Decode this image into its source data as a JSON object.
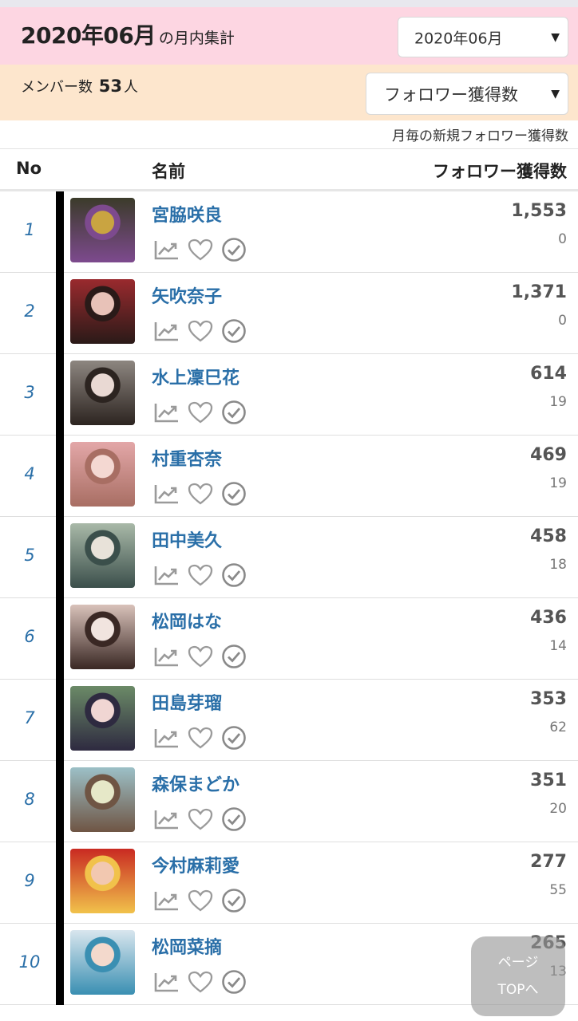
{
  "header": {
    "title_main": "2020年06月",
    "title_suffix": "の月内集計",
    "month_select": "2020年06月"
  },
  "subheader": {
    "members_label": "メンバー数",
    "members_count": "53",
    "members_unit": "人",
    "sort_select": "フォロワー獲得数"
  },
  "note": "月毎の新規フォロワー獲得数",
  "columns": {
    "no": "No",
    "name": "名前",
    "count": "フォロワー獲得数"
  },
  "rows": [
    {
      "rank": "1",
      "name": "宮脇咲良",
      "count": "1,553",
      "delta": "0",
      "avatar_colors": [
        "#3b3b2a",
        "#c9a441",
        "#7d4a8e"
      ]
    },
    {
      "rank": "2",
      "name": "矢吹奈子",
      "count": "1,371",
      "delta": "0",
      "avatar_colors": [
        "#9a2a2e",
        "#e8c2b8",
        "#2a1a18"
      ]
    },
    {
      "rank": "3",
      "name": "水上凜巳花",
      "count": "614",
      "delta": "19",
      "avatar_colors": [
        "#8d8680",
        "#e9d9d3",
        "#2c2420"
      ]
    },
    {
      "rank": "4",
      "name": "村重杏奈",
      "count": "469",
      "delta": "19",
      "avatar_colors": [
        "#e3a7a8",
        "#f4d8d2",
        "#a86e63"
      ]
    },
    {
      "rank": "5",
      "name": "田中美久",
      "count": "458",
      "delta": "18",
      "avatar_colors": [
        "#a9b9a8",
        "#e8e2d9",
        "#3b4f4b"
      ]
    },
    {
      "rank": "6",
      "name": "松岡はな",
      "count": "436",
      "delta": "14",
      "avatar_colors": [
        "#d9c2ba",
        "#f1e4df",
        "#3a2824"
      ]
    },
    {
      "rank": "7",
      "name": "田島芽瑠",
      "count": "353",
      "delta": "62",
      "avatar_colors": [
        "#6b8a67",
        "#f0d6d3",
        "#2e2a40"
      ]
    },
    {
      "rank": "8",
      "name": "森保まどか",
      "count": "351",
      "delta": "20",
      "avatar_colors": [
        "#9cc0c7",
        "#e6e8c8",
        "#6f5544"
      ]
    },
    {
      "rank": "9",
      "name": "今村麻莉愛",
      "count": "277",
      "delta": "55",
      "avatar_colors": [
        "#c92a22",
        "#f2c8b0",
        "#f1c24b"
      ]
    },
    {
      "rank": "10",
      "name": "松岡菜摘",
      "count": "265",
      "delta": "13",
      "avatar_colors": [
        "#d9e6ee",
        "#f3d9cc",
        "#3a8fb2"
      ]
    }
  ],
  "pagetop": {
    "line1": "ページ",
    "line2": "TOPへ"
  },
  "icons": {
    "chart": "trend-chart-icon",
    "heart": "heart-icon",
    "check": "check-circle-icon"
  }
}
